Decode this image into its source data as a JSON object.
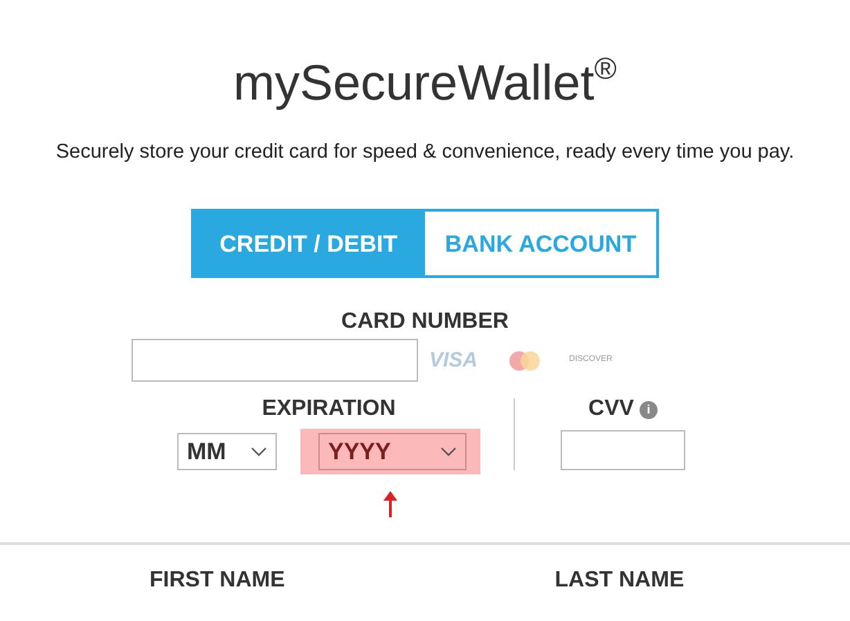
{
  "brand": {
    "name": "mySecureWallet",
    "mark": "®"
  },
  "tagline": "Securely store your credit card for speed & convenience, ready every time you pay.",
  "tabs": [
    {
      "label": "CREDIT / DEBIT",
      "selected": true
    },
    {
      "label": "BANK ACCOUNT",
      "selected": false
    }
  ],
  "card_number": {
    "label": "CARD NUMBER",
    "logos": [
      {
        "kind": "visa",
        "text": "VISA"
      },
      {
        "kind": "mastercard"
      },
      {
        "kind": "discover",
        "text": "DISCOVER"
      }
    ]
  },
  "expiration": {
    "label": "EXPIRATION",
    "month": {
      "value": "MM",
      "error": false
    },
    "year": {
      "value": "YYYY",
      "error": true
    }
  },
  "cvv": {
    "label": "CVV",
    "info": "i"
  },
  "name_labels": [
    "FIRST NAME",
    "LAST NAME"
  ]
}
